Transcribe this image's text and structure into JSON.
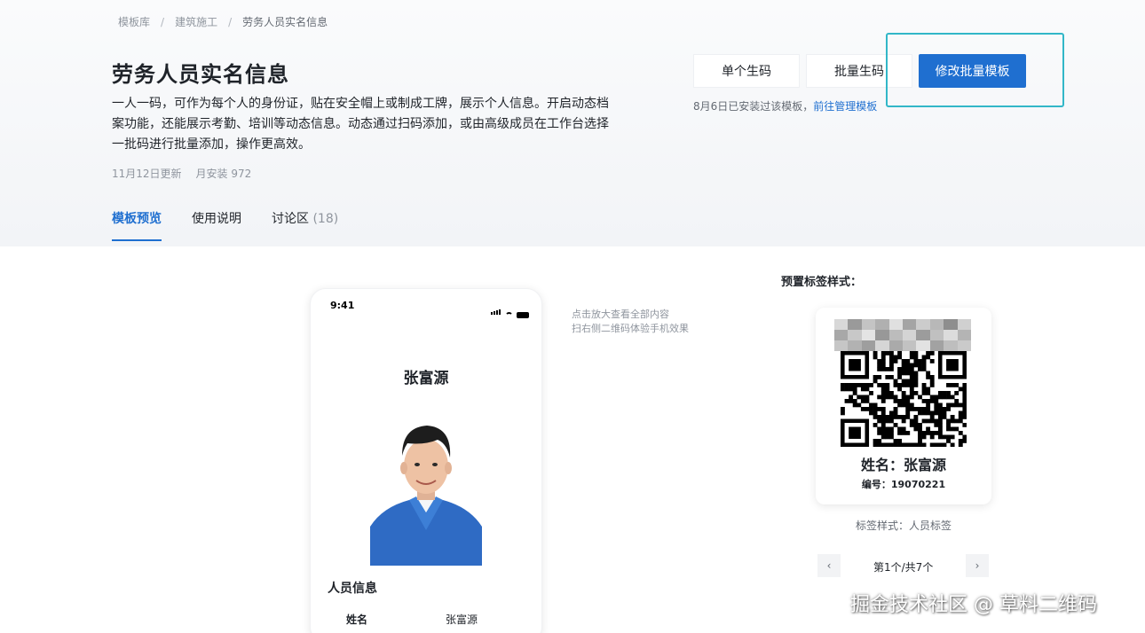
{
  "breadcrumb": {
    "items": [
      "模板库",
      "建筑施工"
    ],
    "current": "劳务人员实名信息",
    "separator": "/"
  },
  "header": {
    "title": "劳务人员实名信息",
    "description": "一人一码，可作为每个人的身份证，贴在安全帽上或制成工牌，展示个人信息。开启动态档案功能，还能展示考勤、培训等动态信息。动态通过扫码添加，或由高级成员在工作台选择一批码进行批量添加，操作更高效。",
    "updated": "11月12日更新",
    "installs": "月安装 972"
  },
  "actions": {
    "single_label": "单个生码",
    "batch_label": "批量生码",
    "edit_batch_label": "修改批量模板",
    "install_note": "8月6日已安装过该模板，",
    "manage_link": "前往管理模板"
  },
  "tabs": [
    {
      "label": "模板预览",
      "active": true
    },
    {
      "label": "使用说明",
      "active": false
    },
    {
      "label": "讨论区",
      "count": "(18)",
      "active": false
    }
  ],
  "phone": {
    "time": "9:41",
    "person_name": "张富源",
    "section_title": "人员信息",
    "rows": [
      {
        "label": "姓名",
        "value": "张富源"
      }
    ]
  },
  "hint": {
    "line1": "点击放大查看全部内容",
    "line2": "扫右侧二维码体验手机效果"
  },
  "label_preview": {
    "title": "预置标签样式：",
    "name_line": "姓名：张富源",
    "number_line": "编号：19070221",
    "style_caption": "标签样式：人员标签",
    "pager_text": "第1个/共7个",
    "prev_icon": "‹",
    "next_icon": "›"
  },
  "watermark": "掘金技术社区 @ 草料二维码",
  "colors": {
    "primary": "#1f6fd0",
    "highlight_border": "#32b7c8",
    "text_primary": "#1f2329",
    "text_secondary": "#8f959e"
  }
}
